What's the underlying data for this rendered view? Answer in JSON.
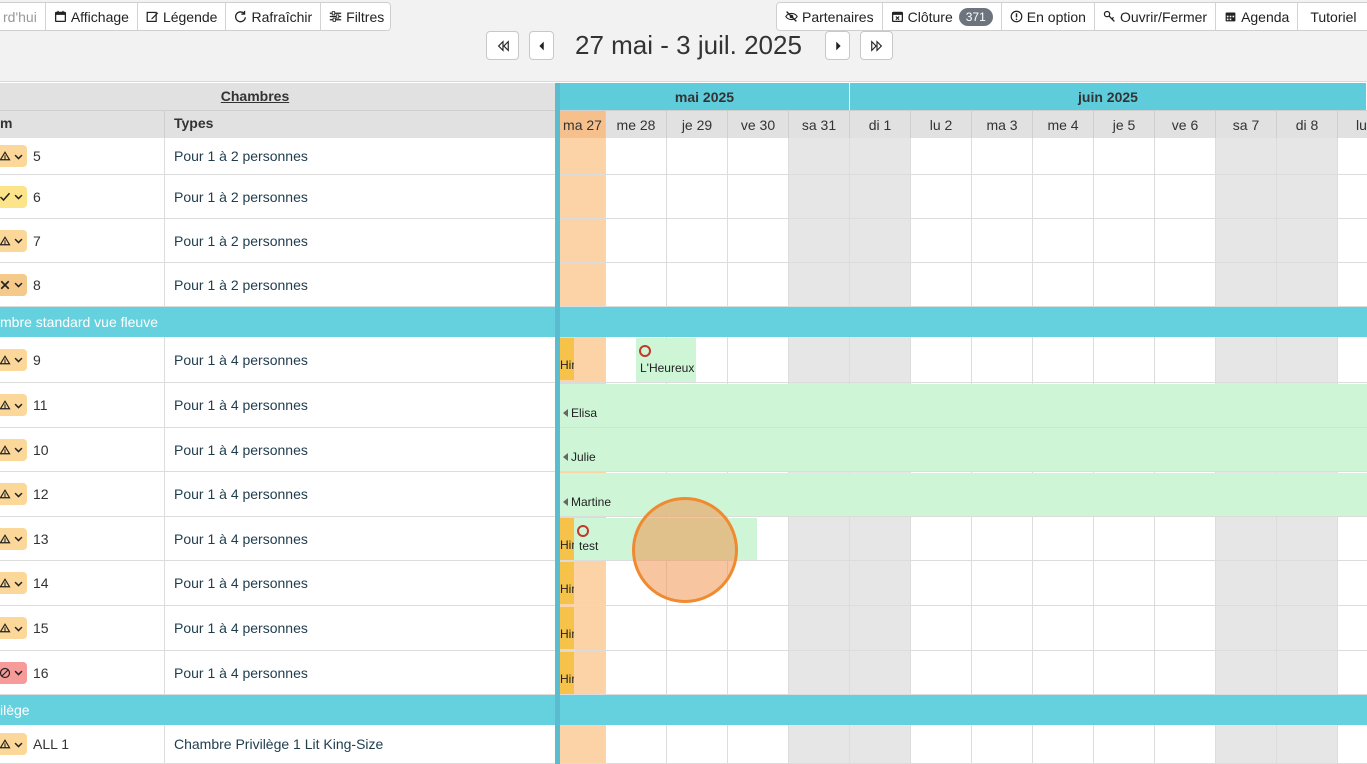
{
  "toolbar": {
    "today_label": "rd'hui",
    "display_label": "Affichage",
    "legend_label": "Légende",
    "refresh_label": "Rafraîchir",
    "filters_label": "Filtres",
    "partners_label": "Partenaires",
    "closure_label": "Clôture",
    "closure_count": "371",
    "option_label": "En option",
    "open_close_label": "Ouvrir/Fermer",
    "agenda_label": "Agenda",
    "tutorial_label": "Tutoriel"
  },
  "nav": {
    "date_range": "27 mai - 3 juil. 2025"
  },
  "rooms_table": {
    "title": "Chambres",
    "col_name": "m",
    "col_types": "Types"
  },
  "rooms": [
    {
      "num": "5",
      "type": "Pour 1 à 2 personnes",
      "status_color": "#fbd89a",
      "icon": "housekeeping-icon"
    },
    {
      "num": "6",
      "type": "Pour 1 à 2 personnes",
      "status_color": "#fce48a",
      "icon": "check-icon"
    },
    {
      "num": "7",
      "type": "Pour 1 à 2 personnes",
      "status_color": "#fbd89a",
      "icon": "housekeeping-icon"
    },
    {
      "num": "8",
      "type": "Pour 1 à 2 personnes",
      "status_color": "#f5c98a",
      "icon": "tools-icon"
    },
    {
      "num": "9",
      "type": "Pour 1 à 4 personnes",
      "status_color": "#fbd89a",
      "icon": "housekeeping-icon"
    },
    {
      "num": "11",
      "type": "Pour 1 à 4 personnes",
      "status_color": "#fbd89a",
      "icon": "housekeeping-icon"
    },
    {
      "num": "10",
      "type": "Pour 1 à 4 personnes",
      "status_color": "#fbd89a",
      "icon": "housekeeping-icon"
    },
    {
      "num": "12",
      "type": "Pour 1 à 4 personnes",
      "status_color": "#fbd89a",
      "icon": "housekeeping-icon"
    },
    {
      "num": "13",
      "type": "Pour 1 à 4 personnes",
      "status_color": "#fbd89a",
      "icon": "housekeeping-icon"
    },
    {
      "num": "14",
      "type": "Pour 1 à 4 personnes",
      "status_color": "#fbd89a",
      "icon": "housekeeping-icon"
    },
    {
      "num": "15",
      "type": "Pour 1 à 4 personnes",
      "status_color": "#fbd89a",
      "icon": "housekeeping-icon"
    },
    {
      "num": "16",
      "type": "Pour 1 à 4 personnes",
      "status_color": "#f79a9a",
      "icon": "blocked-icon"
    },
    {
      "num": "ALL 1",
      "type": "Chambre Privilège 1 Lit King-Size",
      "status_color": "#fbd89a",
      "icon": "housekeeping-icon"
    }
  ],
  "groups": [
    {
      "label": "mbre standard vue fleuve"
    },
    {
      "label": "ilège"
    }
  ],
  "calendar": {
    "months": [
      "mai 2025",
      "juin 2025"
    ],
    "days": [
      "ma 27",
      "me 28",
      "je 29",
      "ve 30",
      "sa 31",
      "di 1",
      "lu 2",
      "ma 3",
      "me 4",
      "je 5",
      "ve 6",
      "sa 7",
      "di 8",
      "lu"
    ]
  },
  "bookings": {
    "heureux": "L'Heureux",
    "elisa": "Elisa",
    "julie": "Julie",
    "martine": "Martine",
    "test": "test",
    "stub_label": "Hin"
  },
  "colors": {
    "accent": "#5fccdc",
    "booking": "#cdf5d6",
    "today": "#fcd3a6",
    "weekend": "#e6e6e6"
  }
}
